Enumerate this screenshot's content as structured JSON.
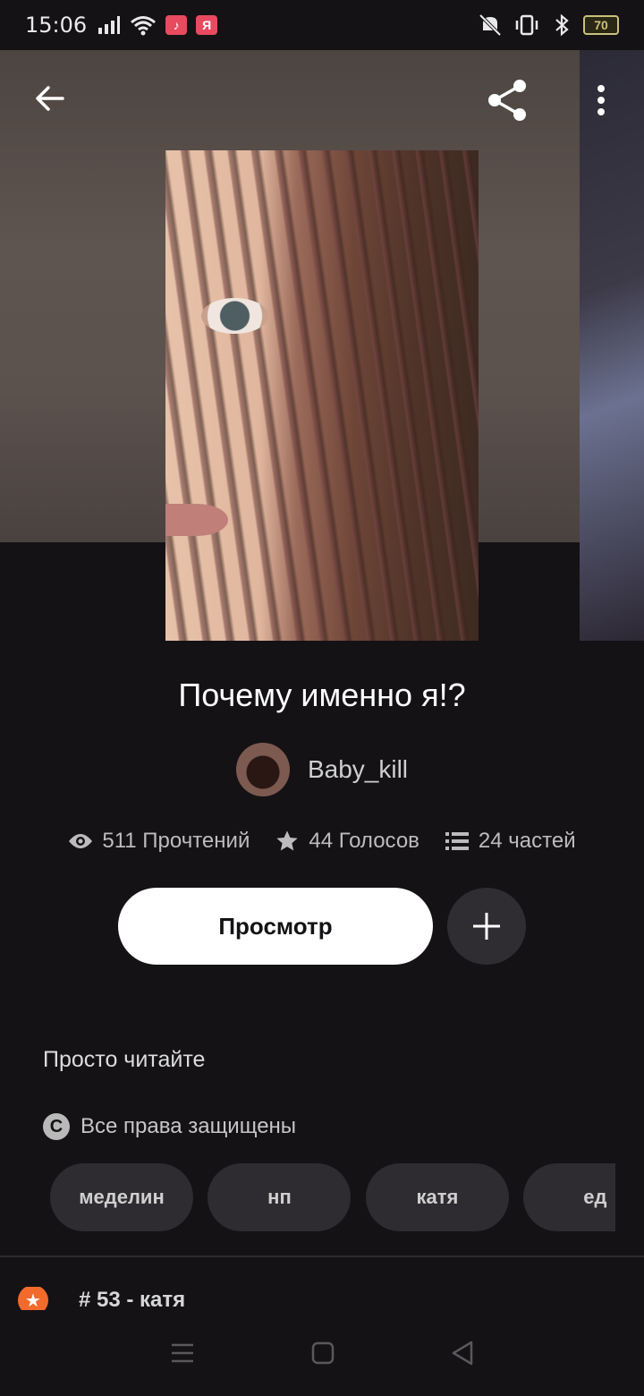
{
  "status_bar": {
    "time": "15:06",
    "app_badges": [
      "♪",
      "Я"
    ],
    "battery": "70"
  },
  "story": {
    "title": "Почему именно я!?",
    "author": "Baby_kill",
    "stats": {
      "reads": "511 Прочтений",
      "votes": "44 Голосов",
      "parts": "24 частей"
    },
    "read_button": "Просмотр",
    "description": "Просто читайте",
    "copyright": "Все права защищены",
    "tags": [
      "меделин",
      "нп",
      "катя",
      "ед"
    ],
    "ranking": "# 53 - катя"
  },
  "colors": {
    "background": "#141215",
    "accent_orange": "#f26a2c",
    "button_white": "#ffffff",
    "tag_bg": "#2e2c30"
  }
}
